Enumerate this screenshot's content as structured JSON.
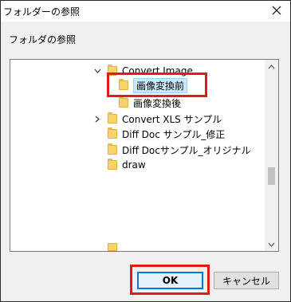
{
  "window": {
    "title": "フォルダーの参照"
  },
  "dialog": {
    "label": "フォルダの参照"
  },
  "tree": {
    "items": [
      {
        "label": "Convert Image",
        "expanded": true
      },
      {
        "label": "画像変換前",
        "selected": true
      },
      {
        "label": "画像変換後"
      },
      {
        "label": "Convert XLS サンプル",
        "collapsed": true
      },
      {
        "label": "Diff Doc サンプル_修正"
      },
      {
        "label": "Diff Docサンプル_オリジナル"
      },
      {
        "label": "draw"
      }
    ]
  },
  "buttons": {
    "ok": "OK",
    "cancel": "キャンセル"
  },
  "colors": {
    "highlight": "#e01b1b",
    "selection": "#cce8ff",
    "ok_border": "#0078d7"
  }
}
